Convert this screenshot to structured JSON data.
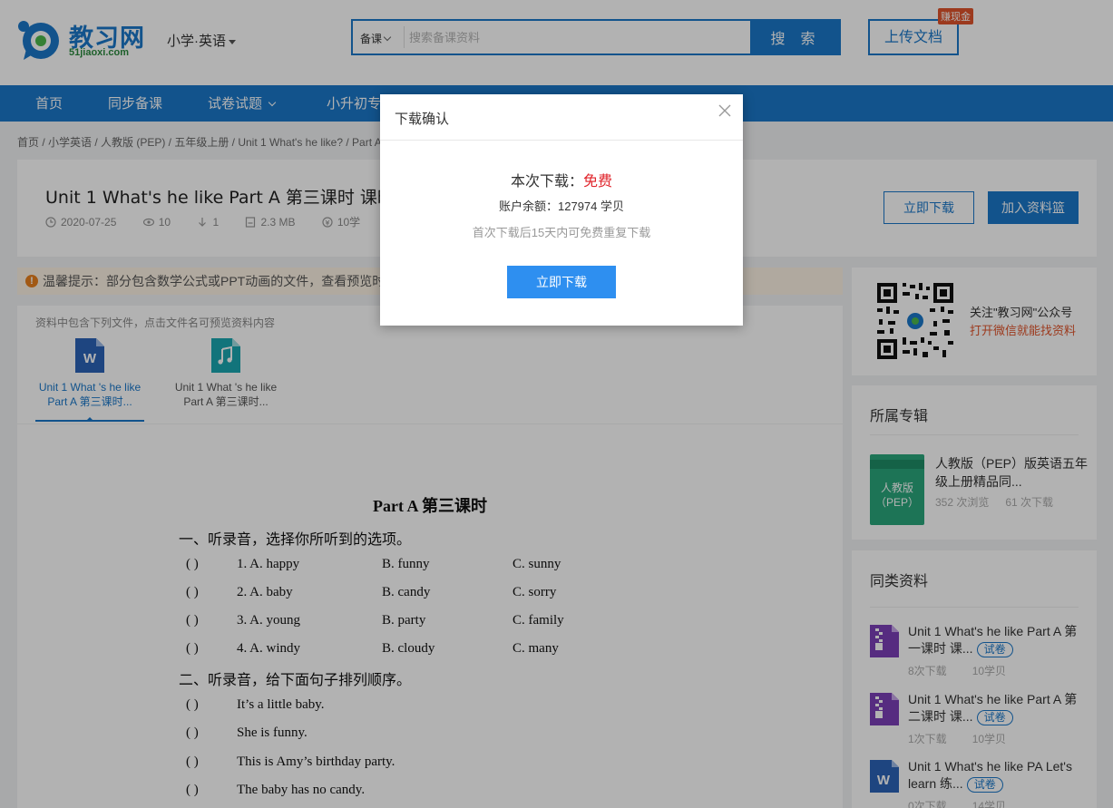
{
  "header": {
    "logo_text": "教习网",
    "logo_sub": "51jiaoxi.com",
    "subject_selector": "小学·英语",
    "search": {
      "type": "备课",
      "placeholder": "搜索备课资料",
      "button": "搜 索"
    },
    "upload_button": "上传文档",
    "earn_badge": "赚现金"
  },
  "nav": {
    "items": [
      {
        "label": "首页"
      },
      {
        "label": "同步备课"
      },
      {
        "label": "试卷试题"
      },
      {
        "label": "小升初专"
      }
    ]
  },
  "breadcrumb": "首页 / 小学英语 / 人教版 (PEP) / 五年级上册 / Unit 1 What's he like? / Part A",
  "document": {
    "title": "Unit 1 What's he like Part A 第三课时 课时",
    "date": "2020-07-25",
    "views": "10",
    "downloads": "1",
    "size": "2.3 MB",
    "price": "10学",
    "download_button": "立即下载",
    "basket_button": "加入资料篮"
  },
  "tip": {
    "text": "温馨提示：部分包含数学公式或PPT动画的文件，查看预览时"
  },
  "files": {
    "hint": "资料中包含下列文件，点击文件名可预览资料内容",
    "items": [
      {
        "name": "Unit 1 What 's he like Part A 第三课时..."
      },
      {
        "name": "Unit 1 What 's he like Part A 第三课时..."
      }
    ]
  },
  "preview": {
    "heading": "Part A  第三课时",
    "section1": "一、听录音，选择你所听到的选项。",
    "q1": [
      {
        "paren": "(      )",
        "a": "1. A. happy",
        "b": "B. funny",
        "c": "C. sunny"
      },
      {
        "paren": "(      )",
        "a": "2. A. baby",
        "b": "B. candy",
        "c": "C. sorry"
      },
      {
        "paren": "(      )",
        "a": "3. A. young",
        "b": "B. party",
        "c": "C. family"
      },
      {
        "paren": "(      )",
        "a": "4. A. windy",
        "b": "B. cloudy",
        "c": "C. many"
      }
    ],
    "section2": "二、听录音，给下面句子排列顺序。",
    "q2": [
      {
        "paren": "(      )",
        "text": "It’s a little  baby."
      },
      {
        "paren": "(      )",
        "text": "She is funny."
      },
      {
        "paren": "(      )",
        "text": "This is Amy’s birthday party."
      },
      {
        "paren": "(      )",
        "text": "The baby has no candy."
      }
    ]
  },
  "sidebar": {
    "qr": {
      "line1": "关注\"教习网\"公众号",
      "line2": "打开微信就能找资料"
    },
    "album": {
      "heading": "所属专辑",
      "cover_line1": "人教版",
      "cover_line2": "（PEP）",
      "title": "人教版（PEP）版英语五年级上册精品同...",
      "views": "352 次浏览",
      "downloads": "61 次下载"
    },
    "similar": {
      "heading": "同类资料",
      "items": [
        {
          "title": "Unit 1 What's he like Part A 第一课时 课...",
          "badge": "试卷",
          "downloads": "8次下载",
          "price": "10学贝",
          "icon": "zip-icon"
        },
        {
          "title": "Unit 1 What's he like Part A 第二课时 课...",
          "badge": "试卷",
          "downloads": "1次下载",
          "price": "10学贝",
          "icon": "zip-icon"
        },
        {
          "title": "Unit 1 What's he like PA Let's learn 练...",
          "badge": "试卷",
          "downloads": "0次下载",
          "price": "14学贝",
          "icon": "word-icon"
        }
      ]
    }
  },
  "modal": {
    "title": "下载确认",
    "line1_prefix": "本次下载：",
    "line1_value": "免费",
    "balance": "账户余额：127974 学贝",
    "note": "首次下载后15天内可免费重复下载",
    "button": "立即下载"
  },
  "colors": {
    "brand": "#1a77c9",
    "accent_red": "#e0242b",
    "modal_button": "#2e8ff0"
  }
}
